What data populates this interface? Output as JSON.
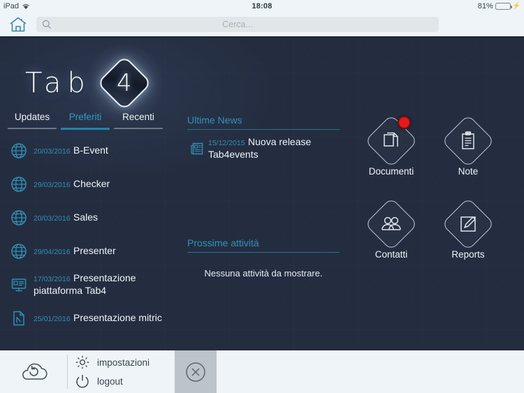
{
  "status_bar": {
    "device": "iPad",
    "wifi_icon": "wifi-icon",
    "time": "18:08",
    "battery_percent": "81%",
    "battery_level": 81,
    "charging_icon": "lightning-bolt-icon"
  },
  "search": {
    "home_icon": "home-icon",
    "search_icon": "search-icon",
    "placeholder": "Cerca...",
    "value": ""
  },
  "logo": {
    "word": "Tab",
    "badge_number": "4"
  },
  "tabs": [
    {
      "label": "Updates",
      "active": false
    },
    {
      "label": "Preferiti",
      "active": true
    },
    {
      "label": "Recenti",
      "active": false
    }
  ],
  "list": [
    {
      "icon": "globe-icon",
      "date": "20/03/2016",
      "title": "B-Event"
    },
    {
      "icon": "globe-icon",
      "date": "29/03/2016",
      "title": "Checker"
    },
    {
      "icon": "globe-icon",
      "date": "20/03/2016",
      "title": "Sales"
    },
    {
      "icon": "globe-icon",
      "date": "29/04/2016",
      "title": "Presenter"
    },
    {
      "icon": "presentation-icon",
      "date": "17/03/2016",
      "title": "Presentazione piattaforma Tab4"
    },
    {
      "icon": "pdf-file-icon",
      "date": "25/01/2016",
      "title": "Presentazione mitric"
    }
  ],
  "news": {
    "title": "Ultime News",
    "items": [
      {
        "icon": "newspaper-icon",
        "date": "15/12/2015",
        "title": "Nuova release Tab4events"
      }
    ]
  },
  "activities": {
    "title": "Prossime attività",
    "empty_message": "Nessuna attività da mostrare."
  },
  "modules": [
    {
      "label": "Documenti",
      "icon": "documents-icon",
      "badge": true
    },
    {
      "label": "Note",
      "icon": "clipboard-icon",
      "badge": false
    },
    {
      "label": "Contatti",
      "icon": "contacts-icon",
      "badge": false
    },
    {
      "label": "Reports",
      "icon": "edit-square-icon",
      "badge": false
    }
  ],
  "toolbar": {
    "sync_icon": "cloud-refresh-icon",
    "settings_icon": "gear-icon",
    "settings_label": "impostazioni",
    "logout_icon": "power-icon",
    "logout_label": "logout",
    "close_icon": "close-circle-icon"
  },
  "colors": {
    "background_dark": "#242d40",
    "accent_teal": "#2f93bb",
    "chrome_light": "#eef4f8",
    "badge_red": "#e01b1b",
    "battery_green": "#4cd250",
    "close_panel_gray": "#bdc4c9"
  }
}
